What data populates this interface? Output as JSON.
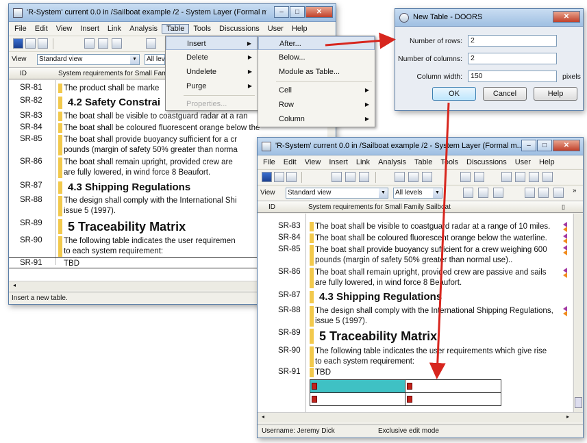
{
  "win1": {
    "title": "'R-System' current 0.0 in /Sailboat example /2 - System Layer (Formal m...",
    "menu": [
      "File",
      "Edit",
      "View",
      "Insert",
      "Link",
      "Analysis",
      "Table",
      "Tools",
      "Discussions",
      "User",
      "Help"
    ],
    "view_combo": "Standard view",
    "level_combo": "All leve",
    "col_id": "ID",
    "col_req": "System requirements for Small Family Sailboat",
    "rows": [
      {
        "id": "SR-81",
        "text": "The product shall be marke"
      },
      {
        "id": "SR-82",
        "text": "4.2 Safety Constrai"
      },
      {
        "id": "SR-83",
        "text": "The boat shall be visible to coastguard radar at a ran"
      },
      {
        "id": "SR-84",
        "text": "The boat shall be coloured fluorescent orange below the waterline."
      },
      {
        "id": "SR-85",
        "text": "The boat shall provide buoyancy sufficient for a cr",
        "text2": "pounds (margin of safety 50% greater than norma"
      },
      {
        "id": "SR-86",
        "text": "The boat shall remain upright, provided crew are",
        "text2": "are fully lowered, in wind force 8 Beaufort."
      },
      {
        "id": "SR-87",
        "text": "4.3 Shipping Regulations"
      },
      {
        "id": "SR-88",
        "text": "The design shall comply with the International Shi",
        "text2": "issue 5 (1997)."
      },
      {
        "id": "SR-89",
        "text": "5 Traceability Matrix"
      },
      {
        "id": "SR-90",
        "text": "The following table indicates the user requiremen",
        "text2": "to each system requirement:"
      },
      {
        "id": "SR-91",
        "text": "TBD"
      }
    ],
    "status": "Insert a new table."
  },
  "table_menu": {
    "items": [
      "Insert",
      "Delete",
      "Undelete",
      "Purge",
      "Properties..."
    ],
    "insert_sub": [
      "After...",
      "Below...",
      "Module as Table...",
      "Cell",
      "Row",
      "Column"
    ]
  },
  "dialog": {
    "title": "New Table - DOORS",
    "rows_label": "Number of rows:",
    "rows_value": "2",
    "cols_label": "Number of columns:",
    "cols_value": "2",
    "width_label": "Column width:",
    "width_value": "150",
    "width_unit": "pixels",
    "ok": "OK",
    "cancel": "Cancel",
    "help": "Help"
  },
  "win2": {
    "title": "'R-System' current 0.0 in /Sailboat example /2 - System Layer (Formal m...",
    "menu": [
      "File",
      "Edit",
      "View",
      "Insert",
      "Link",
      "Analysis",
      "Table",
      "Tools",
      "Discussions",
      "User",
      "Help"
    ],
    "view_combo": "Standard view",
    "level_combo": "All levels",
    "col_id": "ID",
    "col_req": "System requirements for Small Family Sailboat",
    "rows": [
      {
        "id": "SR-83",
        "text": "The boat shall be visible to coastguard radar at a range of 10 miles."
      },
      {
        "id": "SR-84",
        "text": "The boat shall be coloured fluorescent orange below the waterline."
      },
      {
        "id": "SR-85",
        "text": "The boat shall provide buoyancy sufficient for a crew weighing 600",
        "text2": "pounds (margin of safety 50% greater than normal use).."
      },
      {
        "id": "SR-86",
        "text": "The boat shall remain upright, provided crew are passive and sails",
        "text2": "are fully lowered, in wind force 8 Beaufort."
      },
      {
        "id": "SR-87",
        "text": "4.3 Shipping Regulations"
      },
      {
        "id": "SR-88",
        "text": "The design shall comply with the International Shipping Regulations,",
        "text2": "issue 5 (1997)."
      },
      {
        "id": "SR-89",
        "text": "5 Traceability Matrix"
      },
      {
        "id": "SR-90",
        "text": "The following table indicates the user requirements which give rise",
        "text2": "to each system requirement:"
      },
      {
        "id": "SR-91",
        "text": "TBD"
      }
    ],
    "status_user": "Username: Jeremy Dick",
    "status_mode": "Exclusive edit mode"
  },
  "colors": {
    "requirement_bar": "#f2c94c",
    "selected_cell": "#3fc1c4",
    "arrow": "#d7261e"
  }
}
